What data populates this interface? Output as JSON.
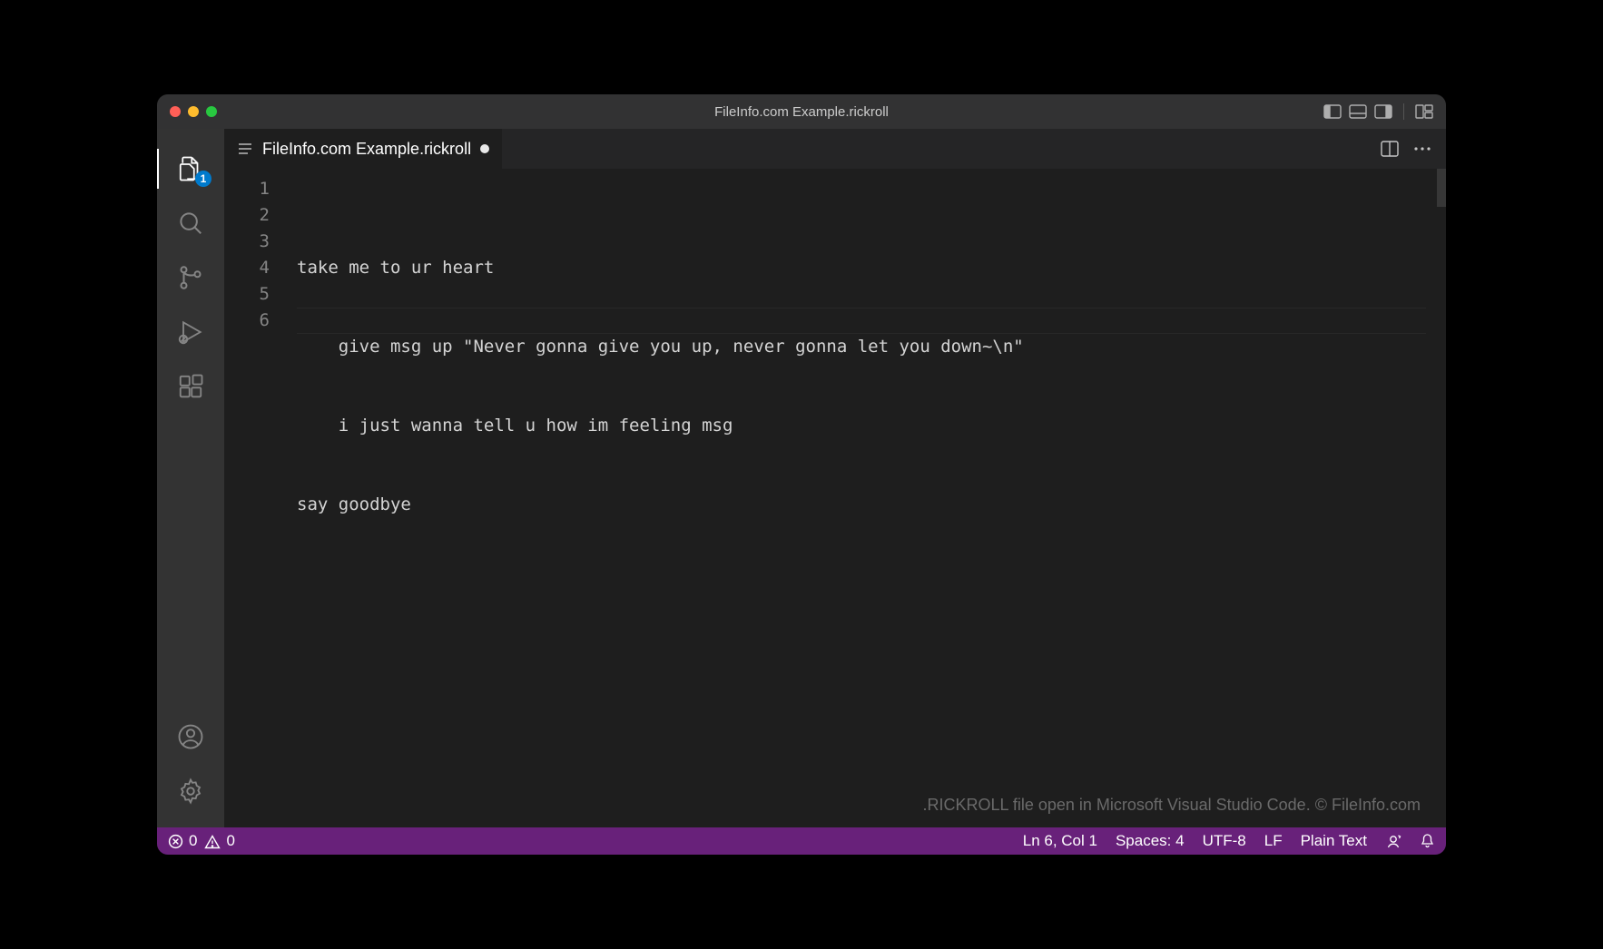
{
  "window": {
    "title": "FileInfo.com Example.rickroll"
  },
  "activity_bar": {
    "explorer_badge": "1"
  },
  "tabs": {
    "items": [
      {
        "label": "FileInfo.com Example.rickroll",
        "modified": true
      }
    ]
  },
  "editor": {
    "line_numbers": [
      "1",
      "2",
      "3",
      "4",
      "5",
      "6"
    ],
    "lines": [
      "take me to ur heart",
      "    give msg up \"Never gonna give you up, never gonna let you down~\\n\"",
      "    i just wanna tell u how im feeling msg",
      "say goodbye",
      "",
      ""
    ],
    "current_line_index": 5,
    "watermark": ".RICKROLL file open in Microsoft Visual Studio Code. © FileInfo.com"
  },
  "status_bar": {
    "errors": "0",
    "warnings": "0",
    "cursor": "Ln 6, Col 1",
    "indent": "Spaces: 4",
    "encoding": "UTF-8",
    "eol": "LF",
    "language": "Plain Text"
  }
}
